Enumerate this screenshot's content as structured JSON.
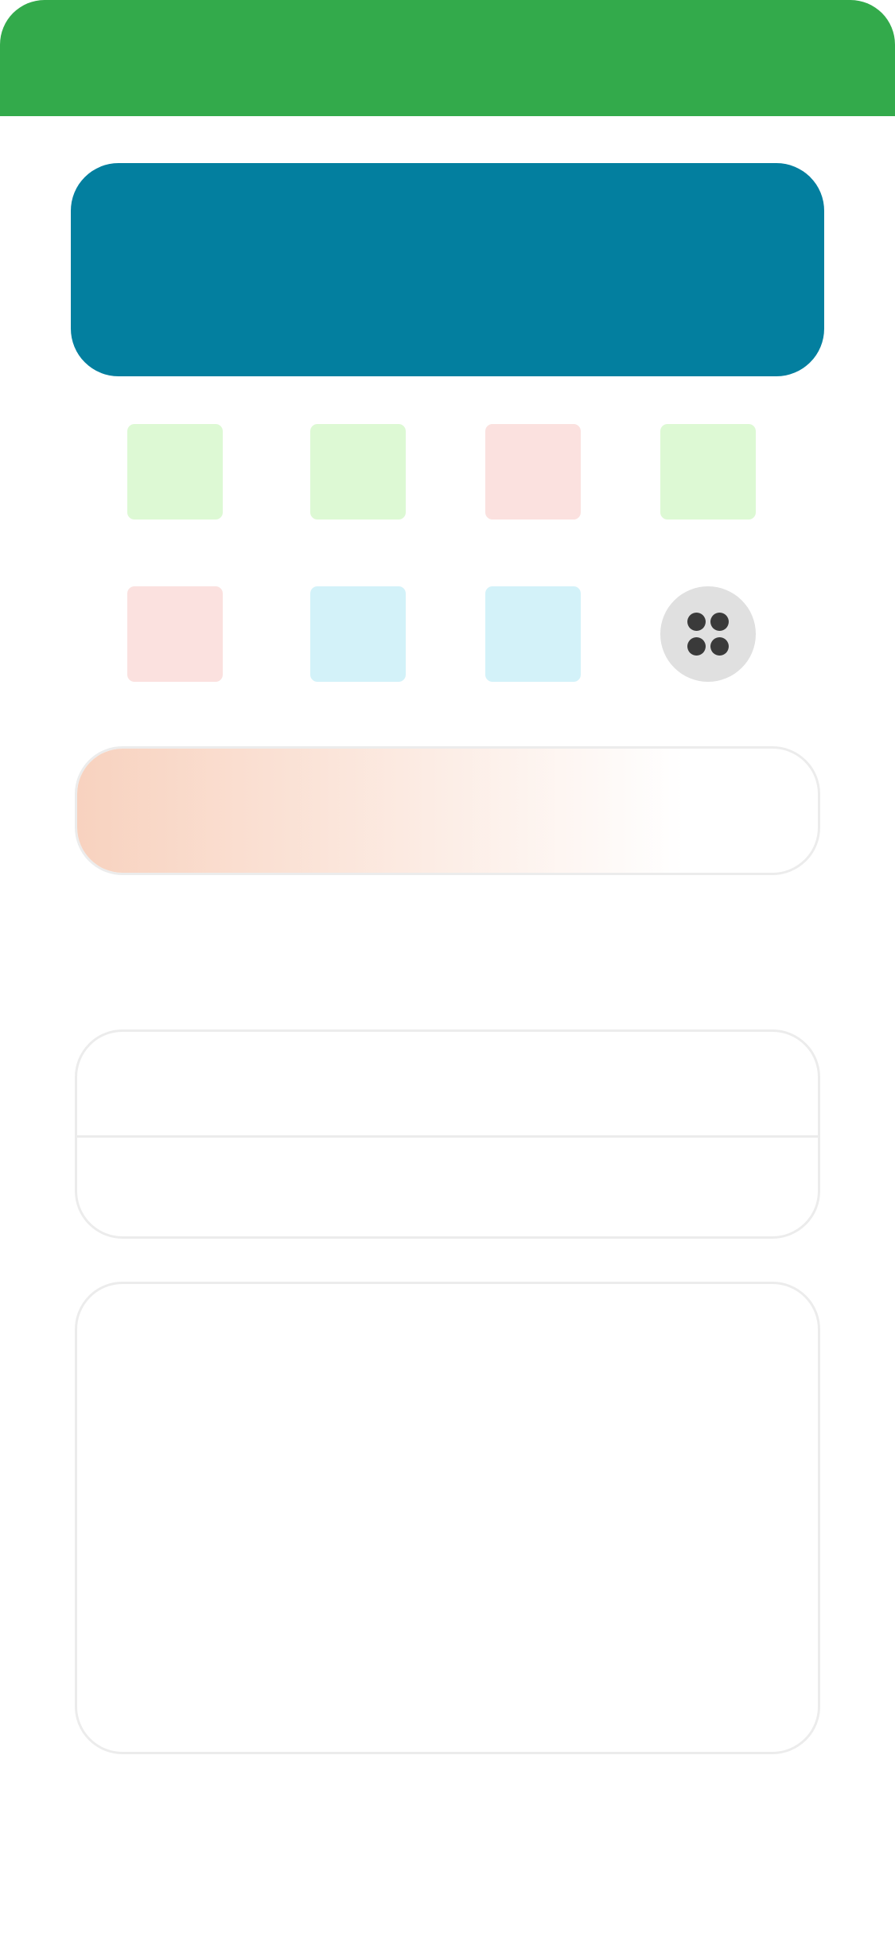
{
  "colors": {
    "header_bg": "#33aa4b",
    "banner_bg": "#037f9f",
    "tile_green": "#ddf9d4",
    "tile_red": "#fbe1df",
    "tile_cyan": "#d3f2f9",
    "more_bg": "#e0e0e0",
    "more_dot": "#3a3a3a",
    "promo_gradient_start": "#f8d2bf",
    "promo_gradient_end": "#ffffff",
    "card_border": "#ececec"
  },
  "shortcuts": [
    {
      "icon": "shortcut-1-icon",
      "tone": "green"
    },
    {
      "icon": "shortcut-2-icon",
      "tone": "green"
    },
    {
      "icon": "shortcut-3-icon",
      "tone": "red"
    },
    {
      "icon": "shortcut-4-icon",
      "tone": "green"
    },
    {
      "icon": "shortcut-5-icon",
      "tone": "red"
    },
    {
      "icon": "shortcut-6-icon",
      "tone": "cyan"
    },
    {
      "icon": "shortcut-7-icon",
      "tone": "cyan"
    },
    {
      "icon": "more-apps-icon",
      "tone": "gray"
    }
  ]
}
